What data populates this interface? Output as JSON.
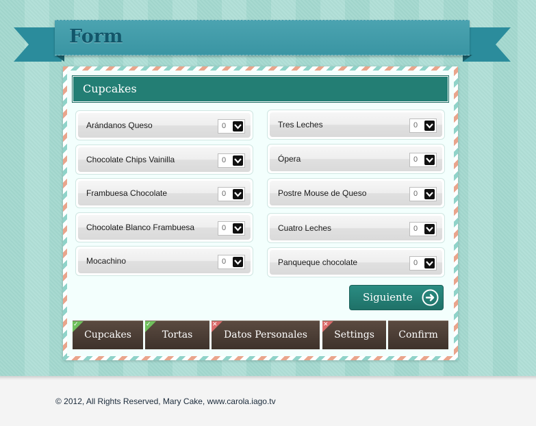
{
  "header": {
    "title": "Form"
  },
  "section": {
    "title": "Cupcakes"
  },
  "items": [
    {
      "label": "Arándanos Queso",
      "qty": "0"
    },
    {
      "label": "Chocolate Chips Vainilla",
      "qty": "0"
    },
    {
      "label": "Frambuesa Chocolate",
      "qty": "0"
    },
    {
      "label": "Chocolate Blanco Frambuesa",
      "qty": "0"
    },
    {
      "label": "Mocachino",
      "qty": "0"
    },
    {
      "label": "Tres Leches",
      "qty": "0"
    },
    {
      "label": "Ópera",
      "qty": "0"
    },
    {
      "label": "Postre Mouse de Queso",
      "qty": "0"
    },
    {
      "label": "Cuatro Leches",
      "qty": "0"
    },
    {
      "label": "Panqueque chocolate",
      "qty": "0"
    }
  ],
  "next_button": {
    "label": "Siguiente"
  },
  "steps": [
    {
      "label": "Cupcakes",
      "status": "complete"
    },
    {
      "label": "Tortas",
      "status": "complete"
    },
    {
      "label": "Datos Personales",
      "status": "error"
    },
    {
      "label": "Settings",
      "status": "error"
    },
    {
      "label": "Confirm",
      "status": "none"
    }
  ],
  "footer": {
    "text": "© 2012, All Rights Reserved, Mary Cake, www.carola.iago.tv"
  },
  "colors": {
    "ribbon": "#3a95a3",
    "section_header": "#237e74",
    "tab_bg": "#3e322b",
    "complete": "#6fbf5c",
    "error": "#d96a6a"
  }
}
